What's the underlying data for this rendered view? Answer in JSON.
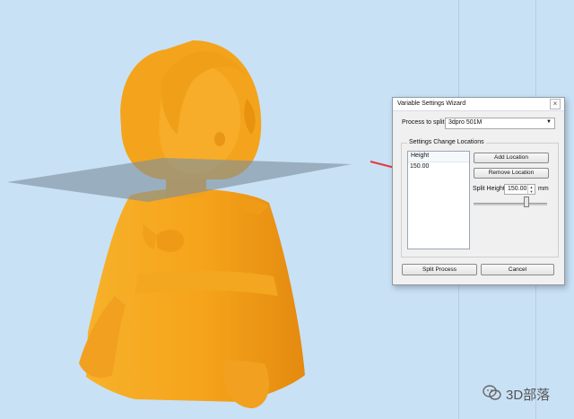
{
  "dialog": {
    "title": "Variable Settings Wizard",
    "close_glyph": "×",
    "process_label": "Process to split",
    "process_value": "3dpro 501M",
    "dropdown_glyph": "▼",
    "group_title": "Settings Change Locations",
    "list_header": "Height",
    "list_items": [
      "150.00"
    ],
    "add_location_label": "Add Location",
    "remove_location_label": "Remove Location",
    "split_height_label": "Split Height",
    "split_height_value": "150.00",
    "split_height_unit": "mm",
    "split_height_slider_fraction": 0.72,
    "split_process_label": "Split Process",
    "cancel_label": "Cancel"
  },
  "watermark": {
    "text": "3D部落"
  },
  "colors": {
    "background": "#c9e1f5",
    "model": "#f5a31a",
    "cutting_plane": "#7c8f9e",
    "annotation_arrow": "#e23b3b"
  },
  "icons": [
    "close-icon",
    "dropdown-arrow-icon",
    "spin-up-icon",
    "spin-down-icon",
    "wechat-icon"
  ]
}
